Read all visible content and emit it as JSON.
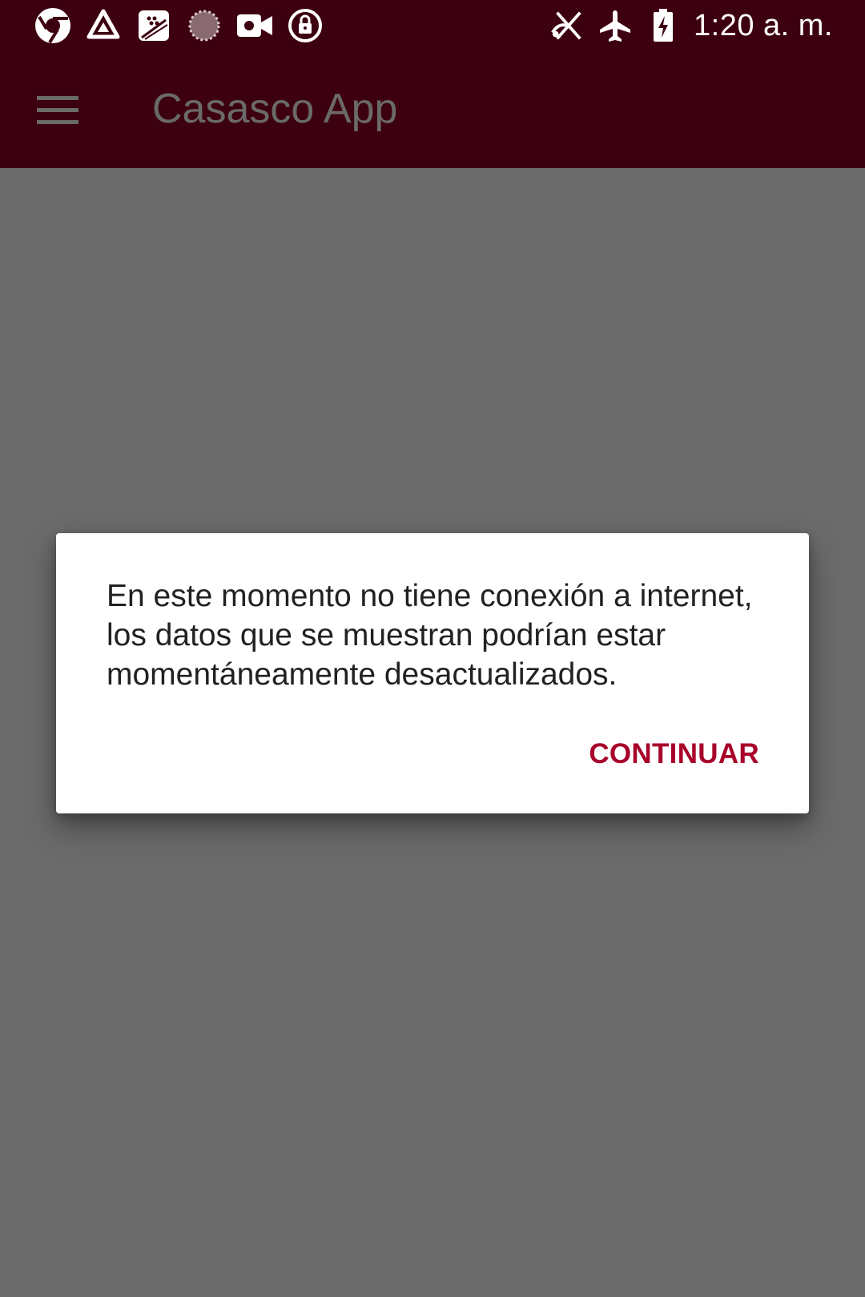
{
  "status_bar": {
    "time": "1:20 a. m.",
    "left_icons": [
      "chrome-like-icon",
      "drive-icon",
      "blackberry-icon",
      "loading-icon",
      "video-camera-icon",
      "lock-circle-icon"
    ],
    "right_icons": [
      "no-signal-icon",
      "airplane-mode-icon",
      "battery-charging-icon"
    ],
    "background_color": "#3d0010"
  },
  "app_bar": {
    "title": "Casasco App",
    "menu_icon": "hamburger-menu-icon",
    "background_color": "#3d0010",
    "title_color": "#6a6a6a"
  },
  "dialog": {
    "message": "En este momento no tiene conexión a internet, los datos que se muestran podrían estar momentáneamente desactualizados.",
    "button_label": "CONTINUAR",
    "button_color": "#a8002a"
  },
  "scrim_color": "#6b6b6b"
}
